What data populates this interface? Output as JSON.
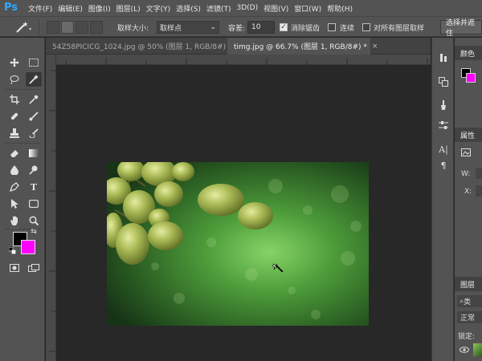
{
  "app": {
    "logo": "Ps"
  },
  "menu": [
    "文件(F)",
    "编辑(E)",
    "图像(I)",
    "图层(L)",
    "文字(Y)",
    "选择(S)",
    "滤镜(T)",
    "3D(D)",
    "视图(V)",
    "窗口(W)",
    "帮助(H)"
  ],
  "options": {
    "sample_size_label": "取样大小:",
    "sample_size_value": "取样点",
    "tolerance_label": "容差:",
    "tolerance_value": "10",
    "antialias_label": "消除锯齿",
    "antialias_checked": true,
    "contiguous_label": "连续",
    "contiguous_checked": false,
    "all_layers_label": "对所有图层取样",
    "all_layers_checked": false,
    "select_mask_label": "选择并遮住"
  },
  "tabs": [
    {
      "label": "54Z58PICICG_1024.jpg @ 50% (图层 1, RGB/8#) *",
      "close": "×",
      "active": false
    },
    {
      "label": "timg.jpg @ 66.7% (图层 1, RGB/8#) *",
      "close": "×",
      "active": true
    }
  ],
  "colors": {
    "foreground": "#000000",
    "background": "#ff00ff",
    "accent": "#31a8ff"
  },
  "panels": {
    "color_title": "颜色",
    "properties_title": "属性",
    "props_w": "W:",
    "props_x": "X:",
    "layers_title": "图层",
    "layers_kind": "类",
    "blend_mode": "正常",
    "lock_label": "锁定:"
  },
  "tools": [
    "move-icon",
    "marquee-icon",
    "lasso-icon",
    "magic-wand-icon",
    "crop-icon",
    "eyedropper-icon",
    "healing-icon",
    "brush-icon",
    "stamp-icon",
    "history-brush-icon",
    "eraser-icon",
    "gradient-icon",
    "blur-icon",
    "dodge-icon",
    "pen-icon",
    "type-icon",
    "path-select-icon",
    "shape-icon",
    "hand-icon",
    "zoom-icon"
  ],
  "tool_glyphs": {
    "type": "T",
    "more": "…"
  }
}
